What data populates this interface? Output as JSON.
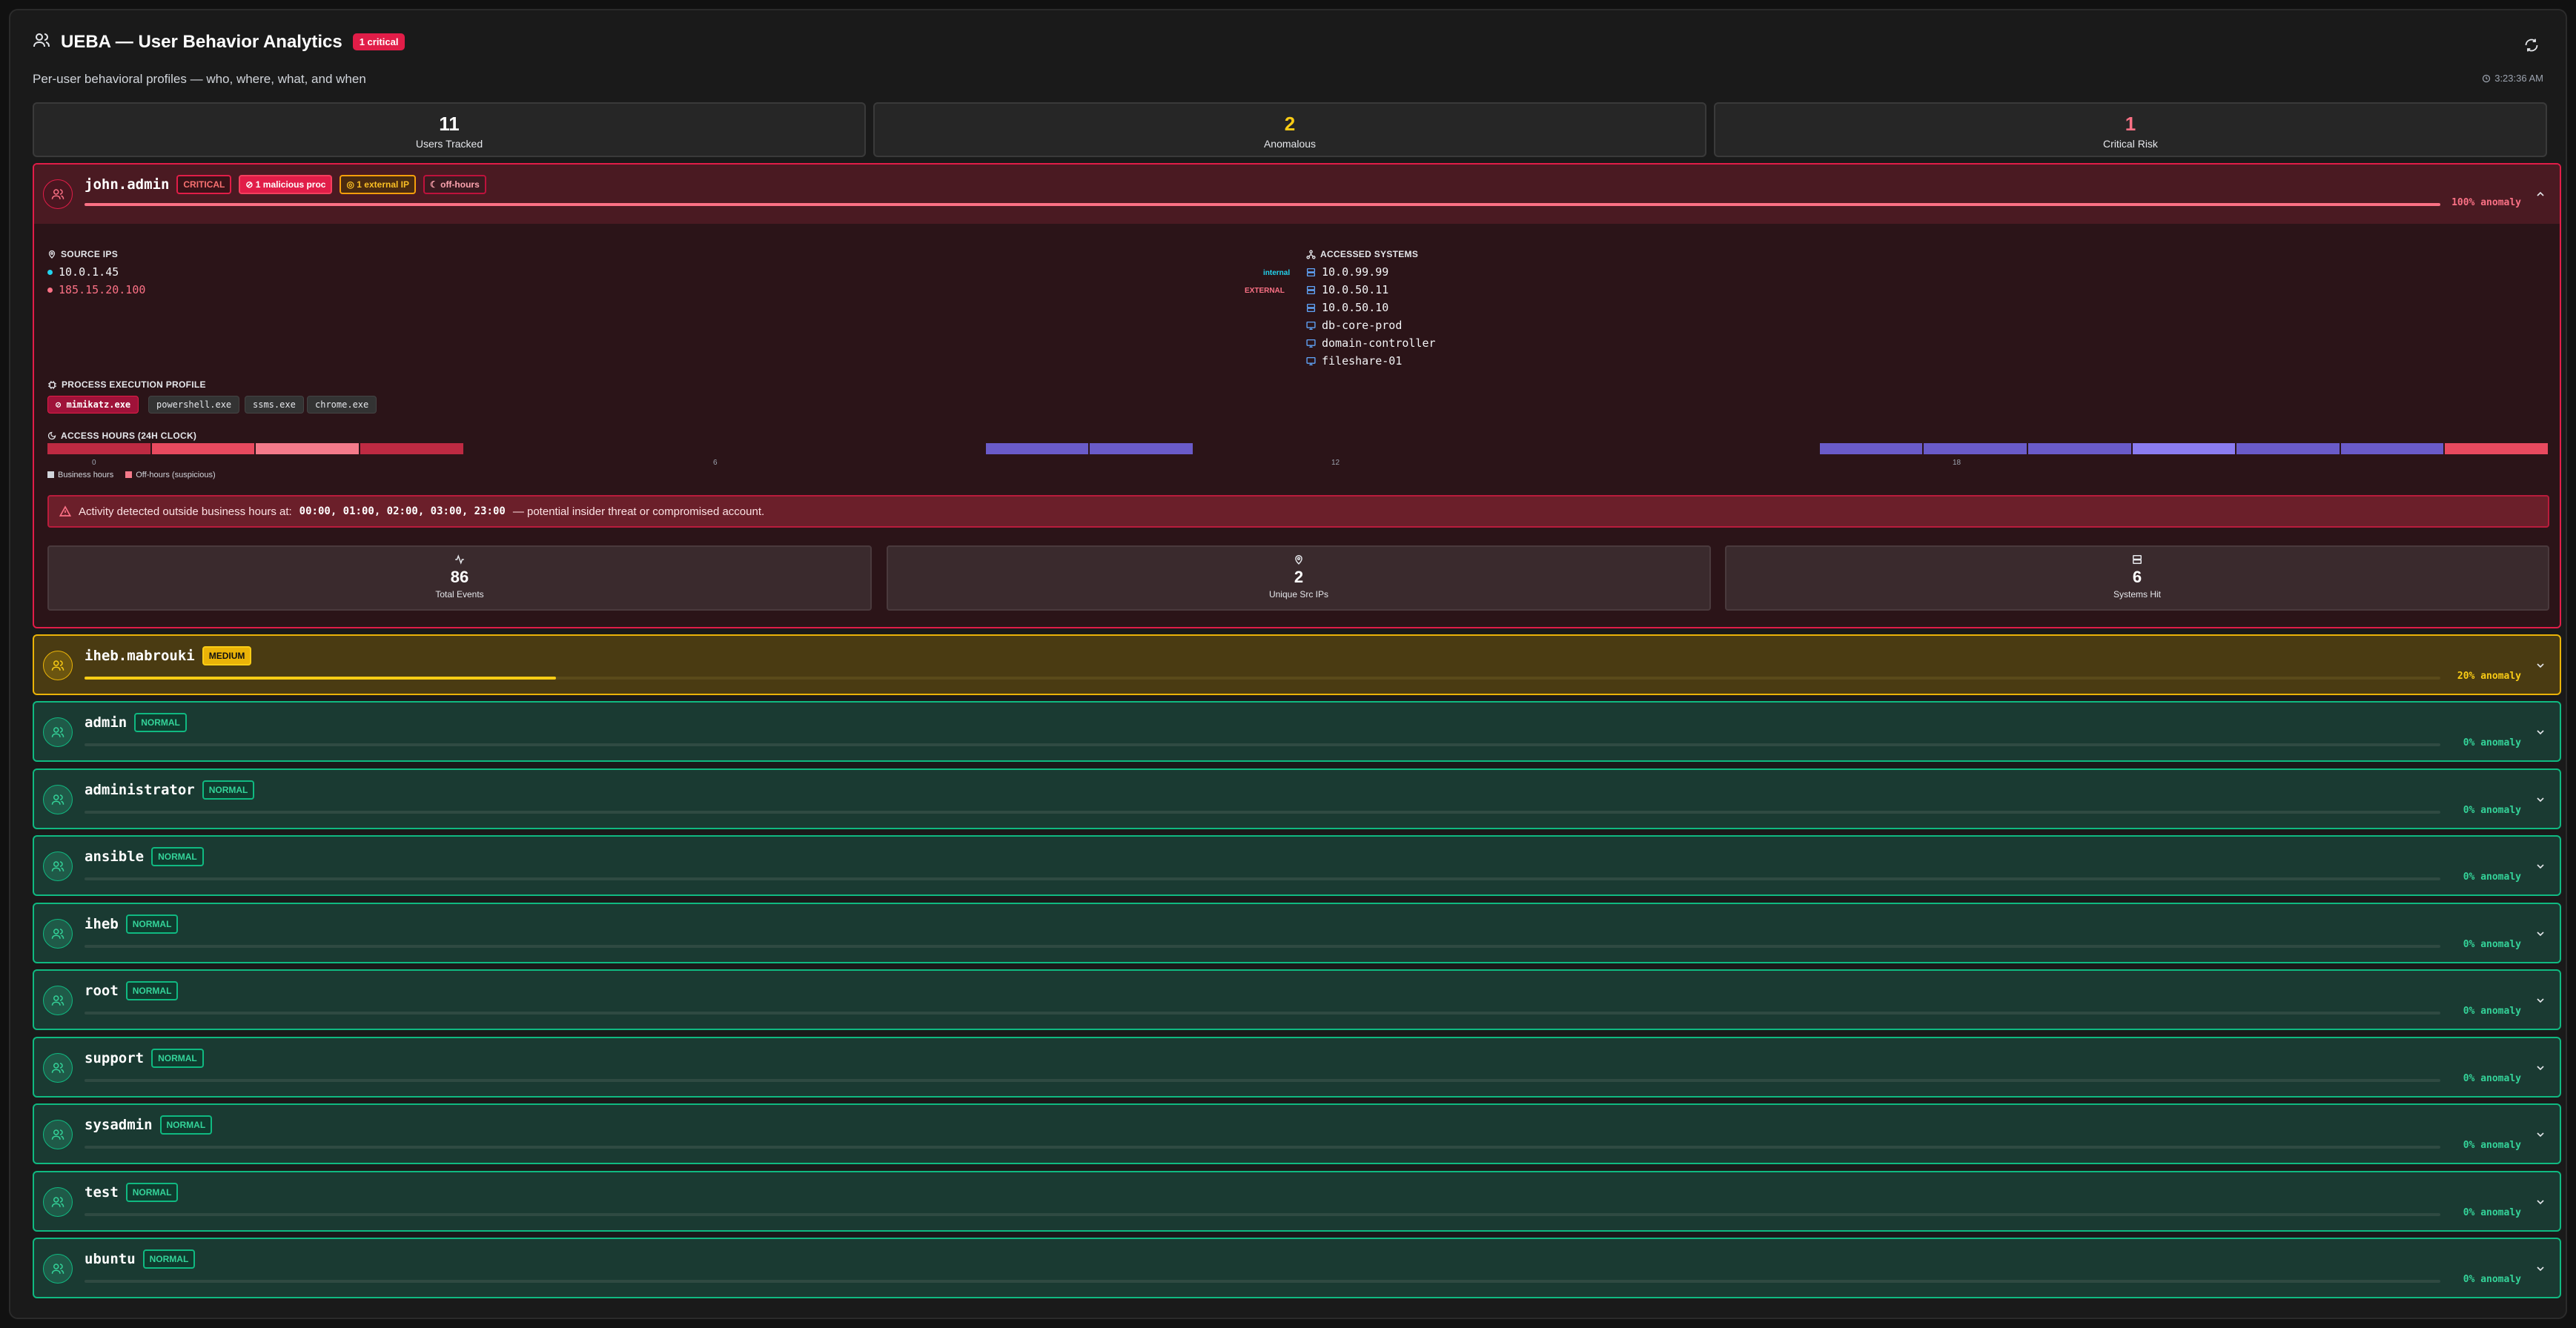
{
  "header": {
    "title": "UEBA — User Behavior Analytics",
    "critical_badge": "1 critical",
    "subtitle": "Per-user behavioral profiles — who, where, what, and when",
    "time": "3:23:36 AM"
  },
  "stats": [
    {
      "value": "11",
      "label": "Users Tracked",
      "color": "#ffffff"
    },
    {
      "value": "2",
      "label": "Anomalous",
      "color": "#facc15"
    },
    {
      "value": "1",
      "label": "Critical Risk",
      "color": "#fb7185"
    }
  ],
  "critical_user": {
    "name": "john.admin",
    "level": "CRITICAL",
    "tags": {
      "proc": "1 malicious proc",
      "ext": "1 external IP",
      "off": "off-hours"
    },
    "anomaly": 1.0,
    "anomaly_label": "100% anomaly",
    "source_ips_title": "SOURCE IPS",
    "source_ips": [
      {
        "ip": "10.0.1.45",
        "zone": "internal",
        "color": "#22d3ee"
      },
      {
        "ip": "185.15.20.100",
        "zone": "EXTERNAL",
        "color": "#fb7185"
      }
    ],
    "systems_title": "ACCESSED SYSTEMS",
    "systems": [
      {
        "name": "10.0.99.99",
        "icon": "server-icon"
      },
      {
        "name": "10.0.50.11",
        "icon": "server-icon"
      },
      {
        "name": "10.0.50.10",
        "icon": "server-icon"
      },
      {
        "name": "db-core-prod",
        "icon": "monitor-icon"
      },
      {
        "name": "domain-controller",
        "icon": "monitor-icon"
      },
      {
        "name": "fileshare-01",
        "icon": "monitor-icon"
      }
    ],
    "process_title": "PROCESS EXECUTION PROFILE",
    "processes": [
      {
        "name": "mimikatz.exe",
        "malicious": true
      },
      {
        "name": "powershell.exe",
        "malicious": false
      },
      {
        "name": "ssms.exe",
        "malicious": false
      },
      {
        "name": "chrome.exe",
        "malicious": false
      }
    ],
    "hours_title": "ACCESS HOURS (24H CLOCK)",
    "hour_ticks": [
      "0",
      "6",
      "12",
      "18"
    ],
    "hours_activity": [
      {
        "hour": 0,
        "level": "off"
      },
      {
        "hour": 1,
        "level": "off-high"
      },
      {
        "hour": 2,
        "level": "off-peak"
      },
      {
        "hour": 3,
        "level": "off"
      },
      {
        "hour": 9,
        "level": "biz"
      },
      {
        "hour": 10,
        "level": "biz"
      },
      {
        "hour": 17,
        "level": "biz"
      },
      {
        "hour": 18,
        "level": "biz"
      },
      {
        "hour": 19,
        "level": "biz"
      },
      {
        "hour": 20,
        "level": "biz-high"
      },
      {
        "hour": 21,
        "level": "biz"
      },
      {
        "hour": 22,
        "level": "biz"
      },
      {
        "hour": 23,
        "level": "off-high"
      }
    ],
    "legend": {
      "business": "Business hours",
      "off": "Off-hours (suspicious)"
    },
    "alert_prefix": "Activity detected outside business hours at:",
    "alert_hours": "00:00, 01:00, 02:00, 03:00, 23:00",
    "alert_suffix": "— potential insider threat or compromised account.",
    "metrics": [
      {
        "value": "86",
        "label": "Total Events",
        "icon": "activity-icon"
      },
      {
        "value": "2",
        "label": "Unique Src IPs",
        "icon": "map-pin-icon"
      },
      {
        "value": "6",
        "label": "Systems Hit",
        "icon": "server-icon"
      }
    ]
  },
  "medium_user": {
    "name": "iheb.mabrouki",
    "level": "MEDIUM",
    "anomaly": 0.2,
    "anomaly_label": "20% anomaly"
  },
  "normal_users": [
    {
      "name": "admin",
      "level": "NORMAL",
      "anomaly_label": "0% anomaly"
    },
    {
      "name": "administrator",
      "level": "NORMAL",
      "anomaly_label": "0% anomaly"
    },
    {
      "name": "ansible",
      "level": "NORMAL",
      "anomaly_label": "0% anomaly"
    },
    {
      "name": "iheb",
      "level": "NORMAL",
      "anomaly_label": "0% anomaly"
    },
    {
      "name": "root",
      "level": "NORMAL",
      "anomaly_label": "0% anomaly"
    },
    {
      "name": "support",
      "level": "NORMAL",
      "anomaly_label": "0% anomaly"
    },
    {
      "name": "sysadmin",
      "level": "NORMAL",
      "anomaly_label": "0% anomaly"
    },
    {
      "name": "test",
      "level": "NORMAL",
      "anomaly_label": "0% anomaly"
    },
    {
      "name": "ubuntu",
      "level": "NORMAL",
      "anomaly_label": "0% anomaly"
    }
  ],
  "colors": {
    "off": "#be2a42",
    "off-high": "#e84a5f",
    "off-peak": "#f47a8a",
    "biz": "#6a5bc9",
    "biz-high": "#8b7cf0"
  }
}
